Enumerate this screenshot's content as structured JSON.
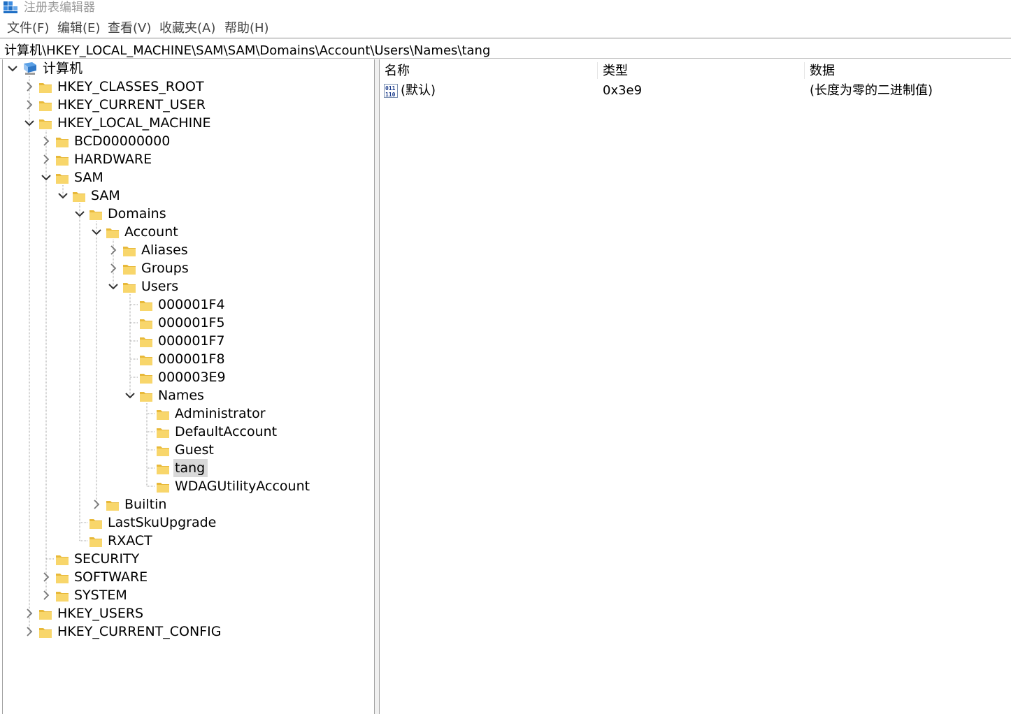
{
  "window": {
    "title": "注册表编辑器"
  },
  "menu": [
    "文件(F)",
    "编辑(E)",
    "查看(V)",
    "收藏夹(A)",
    "帮助(H)"
  ],
  "address": "计算机\\HKEY_LOCAL_MACHINE\\SAM\\SAM\\Domains\\Account\\Users\\Names\\tang",
  "tree": [
    {
      "label": "计算机",
      "depth": 0,
      "state": "expanded",
      "icon": "computer-icon"
    },
    {
      "label": "HKEY_CLASSES_ROOT",
      "depth": 1,
      "state": "collapsed"
    },
    {
      "label": "HKEY_CURRENT_USER",
      "depth": 1,
      "state": "collapsed"
    },
    {
      "label": "HKEY_LOCAL_MACHINE",
      "depth": 1,
      "state": "expanded"
    },
    {
      "label": "BCD00000000",
      "depth": 2,
      "state": "collapsed"
    },
    {
      "label": "HARDWARE",
      "depth": 2,
      "state": "collapsed"
    },
    {
      "label": "SAM",
      "depth": 2,
      "state": "expanded"
    },
    {
      "label": "SAM",
      "depth": 3,
      "state": "expanded"
    },
    {
      "label": "Domains",
      "depth": 4,
      "state": "expanded"
    },
    {
      "label": "Account",
      "depth": 5,
      "state": "expanded"
    },
    {
      "label": "Aliases",
      "depth": 6,
      "state": "collapsed"
    },
    {
      "label": "Groups",
      "depth": 6,
      "state": "collapsed"
    },
    {
      "label": "Users",
      "depth": 6,
      "state": "expanded"
    },
    {
      "label": "000001F4",
      "depth": 7,
      "state": "leaf"
    },
    {
      "label": "000001F5",
      "depth": 7,
      "state": "leaf"
    },
    {
      "label": "000001F7",
      "depth": 7,
      "state": "leaf"
    },
    {
      "label": "000001F8",
      "depth": 7,
      "state": "leaf"
    },
    {
      "label": "000003E9",
      "depth": 7,
      "state": "leaf"
    },
    {
      "label": "Names",
      "depth": 7,
      "state": "expanded"
    },
    {
      "label": "Administrator",
      "depth": 8,
      "state": "leaf"
    },
    {
      "label": "DefaultAccount",
      "depth": 8,
      "state": "leaf"
    },
    {
      "label": "Guest",
      "depth": 8,
      "state": "leaf"
    },
    {
      "label": "tang",
      "depth": 8,
      "state": "leaf",
      "selected": true
    },
    {
      "label": "WDAGUtilityAccount",
      "depth": 8,
      "state": "leaf"
    },
    {
      "label": "Builtin",
      "depth": 5,
      "state": "collapsed"
    },
    {
      "label": "LastSkuUpgrade",
      "depth": 4,
      "state": "leaf"
    },
    {
      "label": "RXACT",
      "depth": 4,
      "state": "leaf"
    },
    {
      "label": "SECURITY",
      "depth": 2,
      "state": "leaf"
    },
    {
      "label": "SOFTWARE",
      "depth": 2,
      "state": "collapsed"
    },
    {
      "label": "SYSTEM",
      "depth": 2,
      "state": "collapsed"
    },
    {
      "label": "HKEY_USERS",
      "depth": 1,
      "state": "collapsed"
    },
    {
      "label": "HKEY_CURRENT_CONFIG",
      "depth": 1,
      "state": "collapsed"
    }
  ],
  "list": {
    "headers": [
      "名称",
      "类型",
      "数据"
    ],
    "rows": [
      {
        "name": "(默认)",
        "type": "0x3e9",
        "data": "(长度为零的二进制值)",
        "icon": "binary-value-icon"
      }
    ]
  },
  "colors": {
    "folder": "#f8d66b",
    "folder_dark": "#e8b93a",
    "selection": "#d9d9d9",
    "tree_line": "#a0a0a0"
  }
}
